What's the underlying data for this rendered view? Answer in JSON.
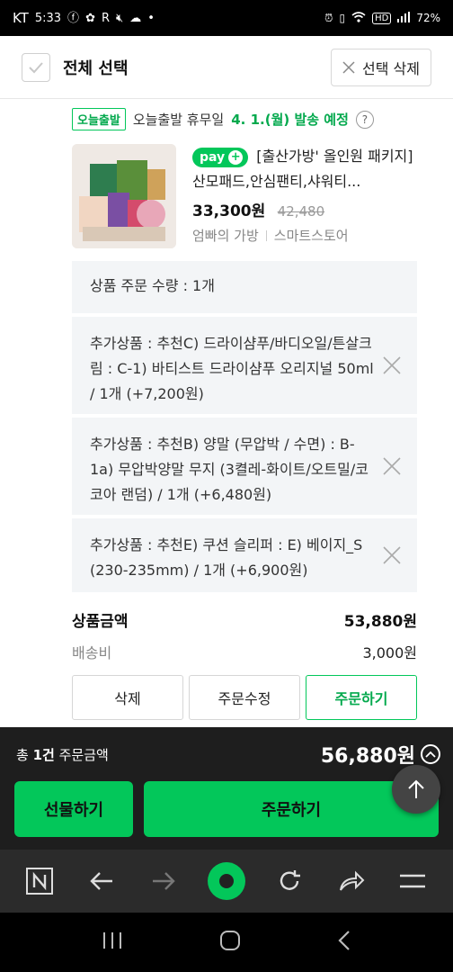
{
  "status_bar": {
    "carrier": "KT",
    "time": "5:33",
    "right_text": "HD",
    "battery": "72%"
  },
  "select_bar": {
    "select_all_label": "전체 선택",
    "delete_selected_label": "선택 삭제"
  },
  "order": {
    "today_badge": "오늘출발",
    "delivery_text": "오늘출발 휴무일",
    "ship_date": "4. 1.(월) 발송 예정",
    "help_symbol": "?",
    "npay_label": "pay",
    "product_title": "[출산가방' 올인원 패키지] 산모패드,안심팬티,샤워티...",
    "price": "33,300원",
    "original_price": "42,480",
    "seller_name": "엄빠의 가방",
    "seller_type": "스마트스토어",
    "quantity_text": "상품 주문 수량 : 1개",
    "options": [
      {
        "text": "추가상품 : 추천C) 드라이샴푸/바디오일/튼살크림 : C-1) 바티스트 드라이샴푸 오리지널 50ml / 1개 (+7,200원)"
      },
      {
        "text": "추가상품 : 추천B) 양말 (무압박 / 수면) : B-1a) 무압박양말 무지 (3켤레-화이트/오트밀/코코아 랜덤) / 1개 (+6,480원)"
      },
      {
        "text": "추가상품 : 추천E) 쿠션 슬리퍼 : E) 베이지_S (230-235mm) / 1개 (+6,900원)"
      }
    ],
    "product_amount_label": "상품금액",
    "product_amount": "53,880원",
    "shipping_label": "배송비",
    "shipping_fee": "3,000원",
    "buttons": {
      "delete": "삭제",
      "modify": "주문수정",
      "order": "주문하기"
    }
  },
  "purchase": {
    "total_prefix": "총 ",
    "total_count": "1건",
    "total_suffix": " 주문금액",
    "total_amount": "56,880원",
    "gift_button": "선물하기",
    "order_button": "주문하기"
  },
  "colors": {
    "accent": "#03c75a",
    "panel_dark": "#1e1e1e",
    "browser_bar": "#2b2b2b"
  }
}
